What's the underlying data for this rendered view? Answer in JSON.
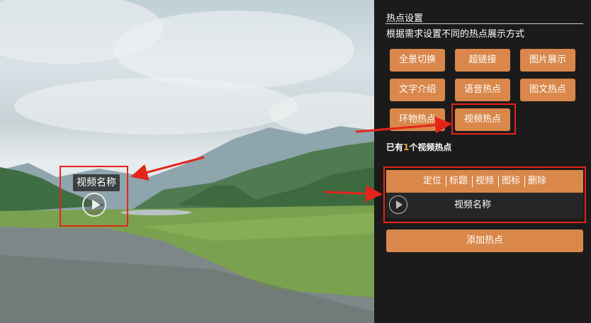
{
  "panorama": {
    "hotspot_label": "视频名称"
  },
  "panel": {
    "title": "热点设置",
    "subtitle": "根据需求设置不同的热点展示方式",
    "buttons": [
      {
        "label": "全景切换"
      },
      {
        "label": "超链接"
      },
      {
        "label": "图片展示"
      },
      {
        "label": "文字介绍"
      },
      {
        "label": "语音热点"
      },
      {
        "label": "图文热点"
      },
      {
        "label": "环物热点"
      },
      {
        "label": "视频热点"
      }
    ],
    "count": {
      "prefix": "已有",
      "number": "1",
      "suffix": "个视频热点"
    },
    "table": {
      "headers": [
        "定位",
        "标题",
        "视频",
        "图标",
        "删除"
      ],
      "rows": [
        {
          "name": "视频名称"
        }
      ]
    },
    "add_button": "添加热点"
  },
  "colors": {
    "accent": "#d9874a",
    "highlight_box": "#e5241a",
    "panel_bg": "#1b1b1b"
  }
}
